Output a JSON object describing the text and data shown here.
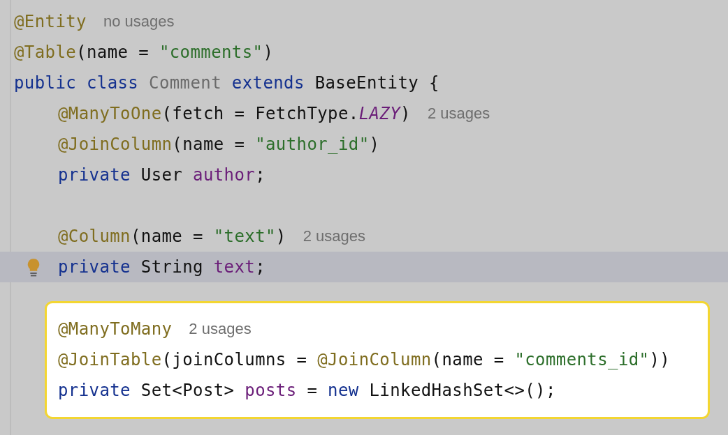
{
  "editor": {
    "header_lines": [
      {
        "kind": "code",
        "current": false,
        "tokens": [
          {
            "kind": "annotation",
            "text": "@Entity"
          }
        ],
        "hint": "no usages"
      },
      {
        "kind": "code",
        "current": false,
        "tokens": [
          {
            "kind": "annotation",
            "text": "@Table"
          },
          {
            "kind": "plain",
            "text": "(name = "
          },
          {
            "kind": "string",
            "text": "\"comments\""
          },
          {
            "kind": "plain",
            "text": ")"
          }
        ]
      },
      {
        "kind": "code",
        "current": false,
        "tokens": [
          {
            "kind": "keyword",
            "text": "public class "
          },
          {
            "kind": "unused",
            "text": "Comment"
          },
          {
            "kind": "keyword",
            "text": " extends "
          },
          {
            "kind": "plain",
            "text": "BaseEntity {"
          }
        ]
      }
    ],
    "body_lines": [
      {
        "kind": "code",
        "current": false,
        "tokens": [
          {
            "kind": "annotation",
            "text": "@ManyToOne"
          },
          {
            "kind": "plain",
            "text": "(fetch = FetchType."
          },
          {
            "kind": "constant",
            "text": "LAZY"
          },
          {
            "kind": "plain",
            "text": ")"
          }
        ],
        "hint": "2 usages"
      },
      {
        "kind": "code",
        "current": false,
        "tokens": [
          {
            "kind": "annotation",
            "text": "@JoinColumn"
          },
          {
            "kind": "plain",
            "text": "(name = "
          },
          {
            "kind": "string",
            "text": "\"author_id\""
          },
          {
            "kind": "plain",
            "text": ")"
          }
        ]
      },
      {
        "kind": "code",
        "current": false,
        "tokens": [
          {
            "kind": "keyword",
            "text": "private "
          },
          {
            "kind": "plain",
            "text": "User "
          },
          {
            "kind": "field",
            "text": "author"
          },
          {
            "kind": "plain",
            "text": ";"
          }
        ]
      },
      {
        "kind": "blank",
        "current": false
      },
      {
        "kind": "code",
        "current": false,
        "tokens": [
          {
            "kind": "annotation",
            "text": "@Column"
          },
          {
            "kind": "plain",
            "text": "(name = "
          },
          {
            "kind": "string",
            "text": "\"text\""
          },
          {
            "kind": "plain",
            "text": ")"
          }
        ],
        "hint": "2 usages"
      },
      {
        "kind": "code",
        "current": true,
        "intention_bulb": true,
        "tokens": [
          {
            "kind": "keyword",
            "text": "private "
          },
          {
            "kind": "plain",
            "text": "String "
          },
          {
            "kind": "field",
            "text": "text"
          },
          {
            "kind": "plain",
            "text": ";"
          }
        ]
      }
    ],
    "highlight_box": {
      "lines": [
        {
          "kind": "code",
          "tokens": [
            {
              "kind": "annotation",
              "text": "@ManyToMany"
            }
          ],
          "hint": "2 usages"
        },
        {
          "kind": "code",
          "tokens": [
            {
              "kind": "annotation",
              "text": "@JoinTable"
            },
            {
              "kind": "plain",
              "text": "(joinColumns = "
            },
            {
              "kind": "annotation",
              "text": "@JoinColumn"
            },
            {
              "kind": "plain",
              "text": "(name = "
            },
            {
              "kind": "string",
              "text": "\"comments_id\""
            },
            {
              "kind": "plain",
              "text": "))"
            }
          ]
        },
        {
          "kind": "code",
          "tokens": [
            {
              "kind": "keyword",
              "text": "private "
            },
            {
              "kind": "plain",
              "text": "Set<Post> "
            },
            {
              "kind": "field",
              "text": "posts"
            },
            {
              "kind": "plain",
              "text": " = "
            },
            {
              "kind": "keyword",
              "text": "new "
            },
            {
              "kind": "plain",
              "text": "LinkedHashSet<>();"
            }
          ]
        }
      ]
    }
  }
}
